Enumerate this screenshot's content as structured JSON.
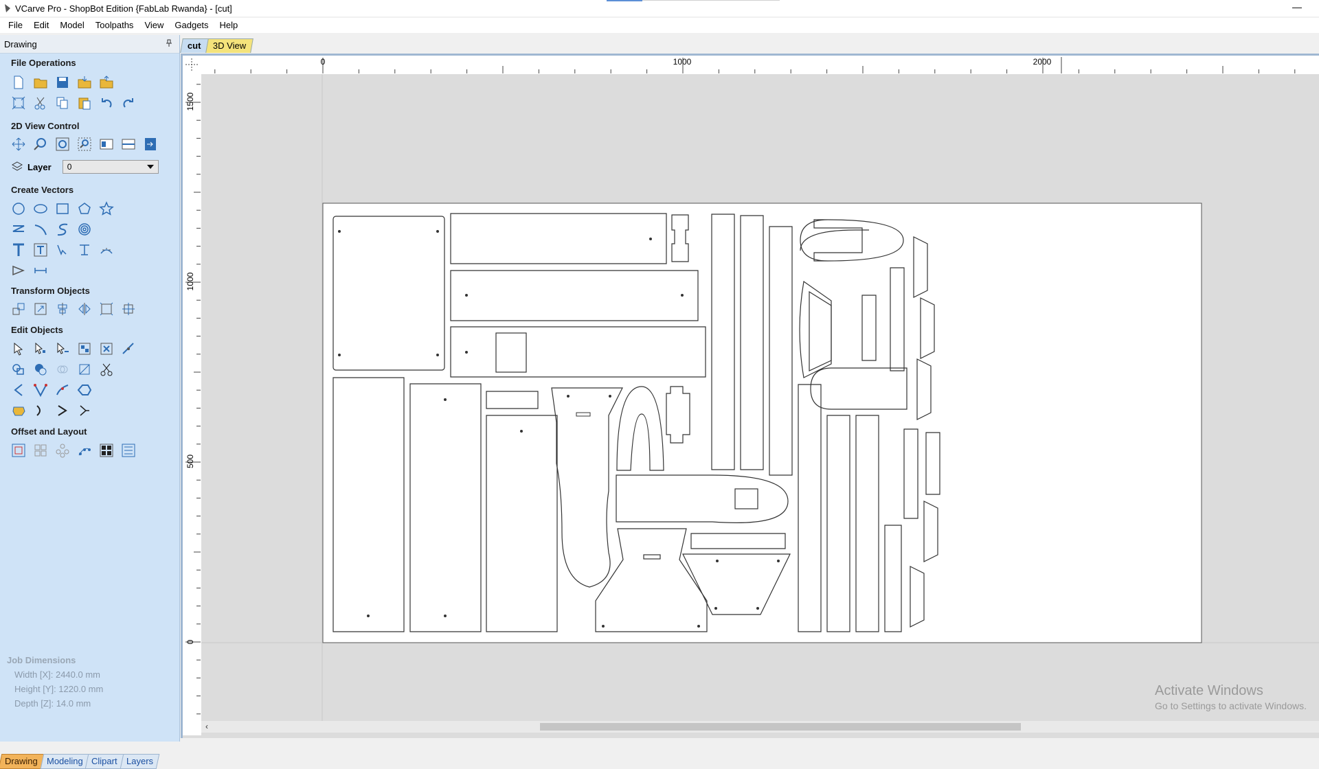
{
  "window": {
    "title": "VCarve Pro - ShopBot Edition {FabLab Rwanda} - [cut]",
    "minimize_glyph": "—"
  },
  "menu": [
    "File",
    "Edit",
    "Model",
    "Toolpaths",
    "View",
    "Gadgets",
    "Help"
  ],
  "sidebar": {
    "panel_title": "Drawing",
    "sections": {
      "file_ops": "File Operations",
      "view_control": "2D View Control",
      "create_vectors": "Create Vectors",
      "transform": "Transform Objects",
      "edit": "Edit Objects",
      "offset": "Offset and Layout"
    },
    "layer": {
      "label": "Layer",
      "value": "0"
    },
    "job": {
      "heading": "Job Dimensions",
      "width": "Width  [X]: 2440.0 mm",
      "height": "Height [Y]: 1220.0 mm",
      "depth": "Depth  [Z]: 14.0 mm"
    },
    "bottom_tabs": [
      "Drawing",
      "Modeling",
      "Clipart",
      "Layers"
    ]
  },
  "doc_tabs": [
    "cut",
    "3D View"
  ],
  "ruler": {
    "top_labels": [
      "0",
      "1000",
      "2000"
    ],
    "left_labels": [
      "1500",
      "1000",
      "500",
      "0"
    ]
  },
  "watermark": {
    "line1": "Activate Windows",
    "line2": "Go to Settings to activate Windows."
  },
  "colors": {
    "panel_bg": "#cfe3f7",
    "active_tab": "#f2b35a",
    "icon_blue": "#2e6db4",
    "icon_yellow": "#e9b73a"
  }
}
